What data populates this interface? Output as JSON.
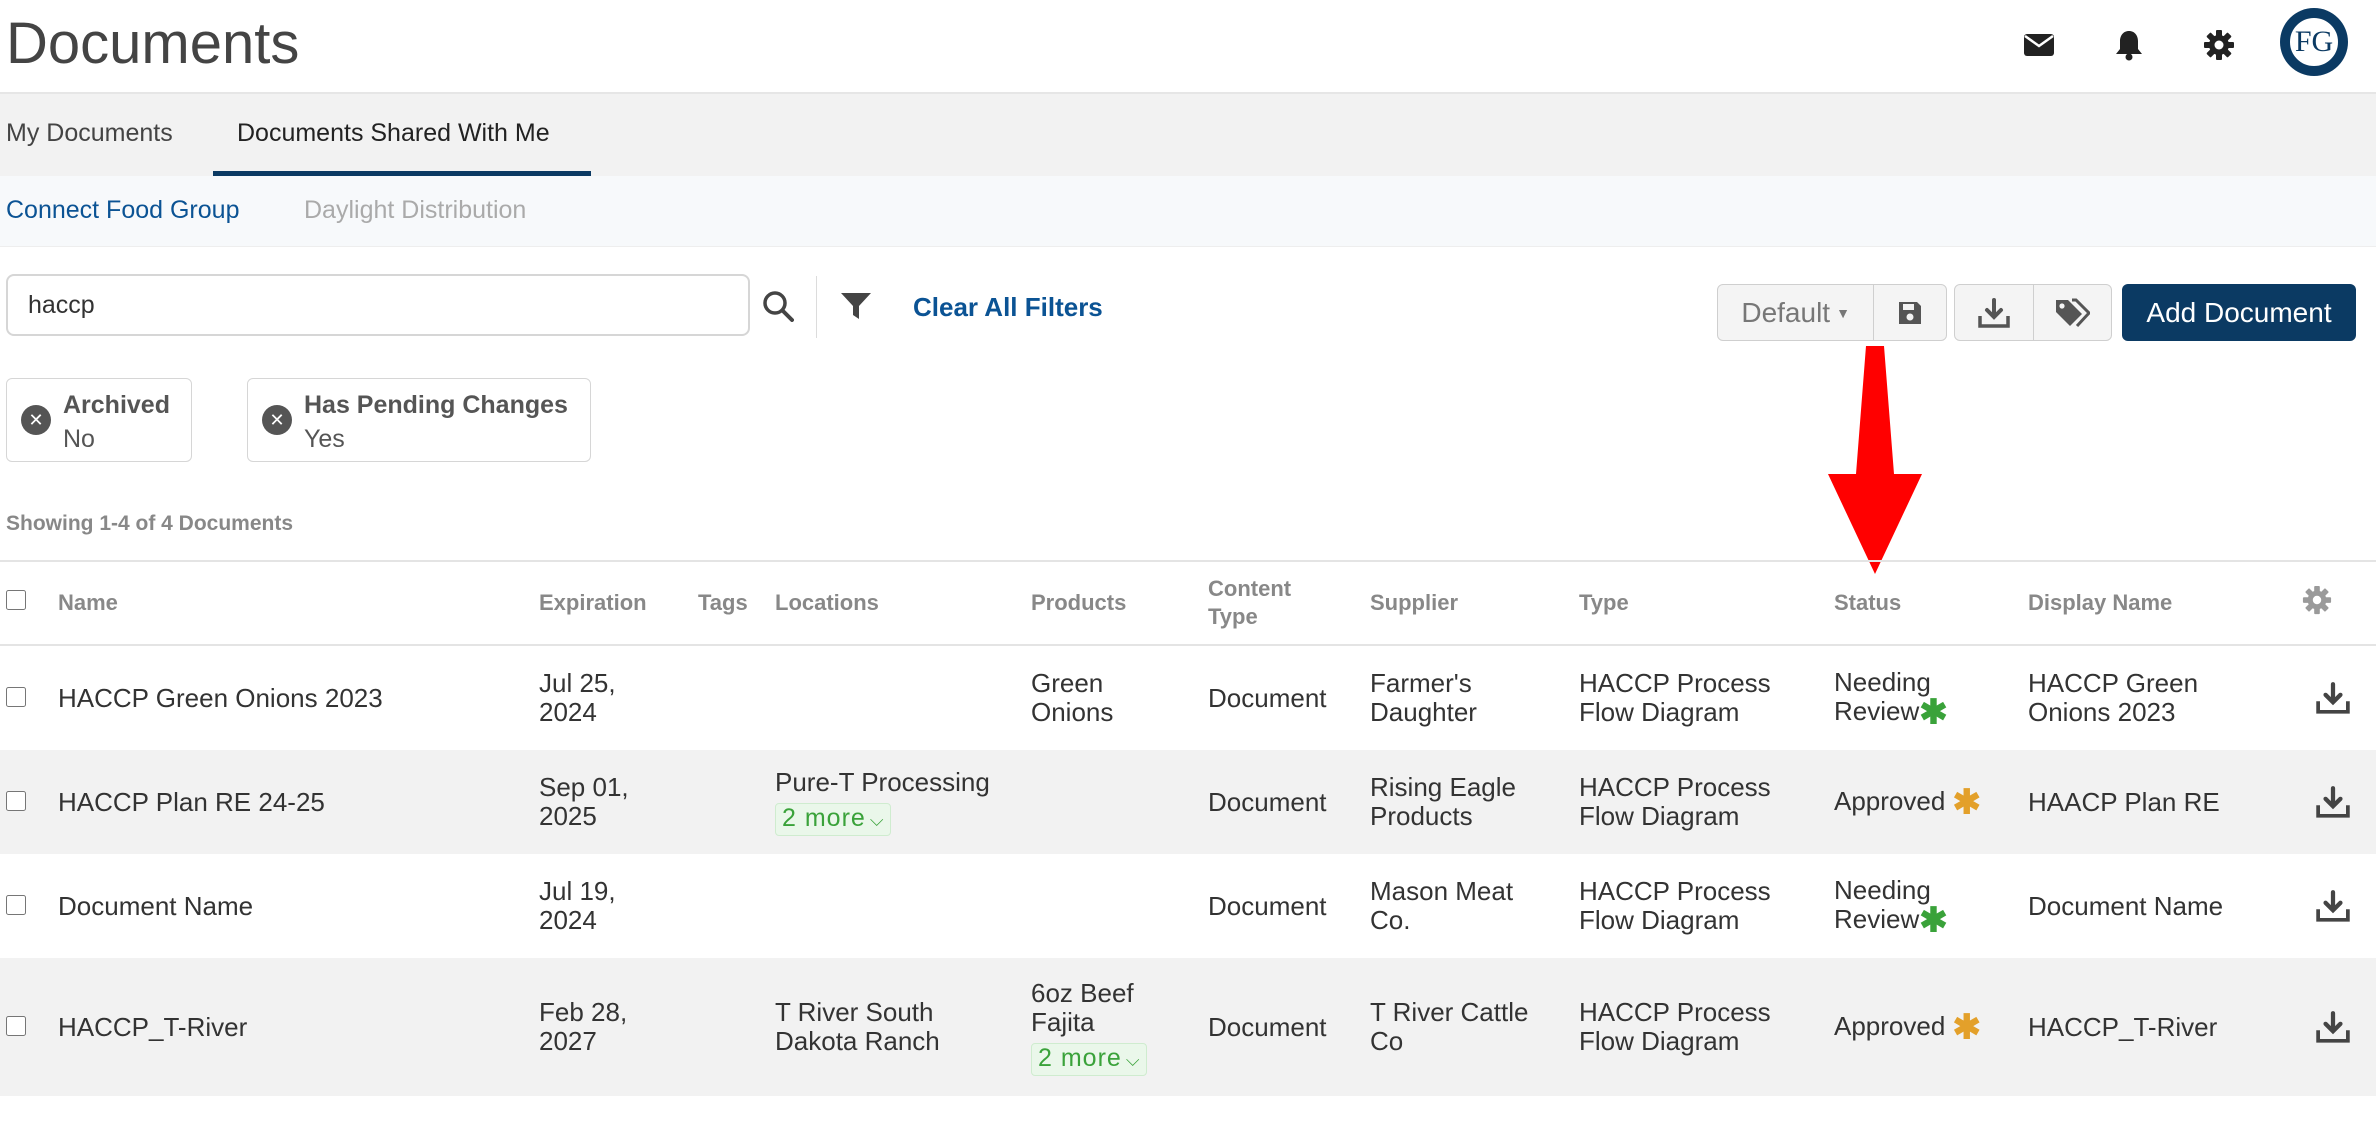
{
  "header": {
    "title": "Documents",
    "avatar_text": "FG"
  },
  "tabs": [
    {
      "label": "My Documents",
      "active": false
    },
    {
      "label": "Documents Shared With Me",
      "active": true
    }
  ],
  "subtabs": [
    {
      "label": "Connect Food Group",
      "active": true
    },
    {
      "label": "Daylight Distribution",
      "active": false
    }
  ],
  "search": {
    "value": "haccp",
    "placeholder": ""
  },
  "filters": {
    "clear_label": "Clear All Filters",
    "chips": [
      {
        "label": "Archived",
        "value": "No"
      },
      {
        "label": "Has Pending Changes",
        "value": "Yes"
      }
    ]
  },
  "toolbar": {
    "view_select": "Default",
    "add_label": "Add Document"
  },
  "showing": "Showing 1-4 of 4 Documents",
  "table": {
    "columns": {
      "name": "Name",
      "expiration": "Expiration",
      "tags": "Tags",
      "locations": "Locations",
      "products": "Products",
      "content_type_1": "Content",
      "content_type_2": "Type",
      "supplier": "Supplier",
      "type": "Type",
      "status": "Status",
      "display_name": "Display Name"
    },
    "rows": [
      {
        "name": "HACCP Green Onions 2023",
        "exp1": "Jul 25,",
        "exp2": "2024",
        "tags": "",
        "loc1": "",
        "loc2": "",
        "loc_more": "",
        "prod1": "Green",
        "prod2": "Onions",
        "prod_more": "",
        "content_type": "Document",
        "sup1": "Farmer's",
        "sup2": "Daughter",
        "type1": "HACCP Process",
        "type2": "Flow Diagram",
        "status1": "Needing",
        "status2": "Review",
        "display_name1": "HACCP Green",
        "display_name2": "Onions 2023"
      },
      {
        "name": "HACCP Plan RE 24-25",
        "exp1": "Sep 01,",
        "exp2": "2025",
        "tags": "",
        "loc1": "Pure-T Processing",
        "loc2": "",
        "loc_more": "2 more",
        "prod1": "",
        "prod2": "",
        "prod_more": "",
        "content_type": "Document",
        "sup1": "Rising Eagle",
        "sup2": "Products",
        "type1": "HACCP Process",
        "type2": "Flow Diagram",
        "status1": "Approved",
        "status2": "",
        "display_name1": "HAACP Plan RE",
        "display_name2": ""
      },
      {
        "name": "Document Name",
        "exp1": "Jul 19,",
        "exp2": "2024",
        "tags": "",
        "loc1": "",
        "loc2": "",
        "loc_more": "",
        "prod1": "",
        "prod2": "",
        "prod_more": "",
        "content_type": "Document",
        "sup1": "Mason Meat",
        "sup2": "Co.",
        "type1": "HACCP Process",
        "type2": "Flow Diagram",
        "status1": "Needing",
        "status2": "Review",
        "display_name1": "Document Name",
        "display_name2": ""
      },
      {
        "name": "HACCP_T-River",
        "exp1": "Feb 28,",
        "exp2": "2027",
        "tags": "",
        "loc1": "T River South",
        "loc2": "Dakota Ranch",
        "loc_more": "",
        "prod1": "6oz Beef",
        "prod2": "Fajita",
        "prod_more": "2 more",
        "content_type": "Document",
        "sup1": "T River Cattle",
        "sup2": "Co",
        "type1": "HACCP Process",
        "type2": "Flow Diagram",
        "status1": "Approved",
        "status2": "",
        "display_name1": "HACCP_T-River",
        "display_name2": ""
      }
    ]
  },
  "colors": {
    "brand": "#0b3a63",
    "link": "#0b5394",
    "needing_review_star": "#3aa23a",
    "approved_star": "#e3a02a",
    "annotation_arrow": "#ff0000"
  }
}
